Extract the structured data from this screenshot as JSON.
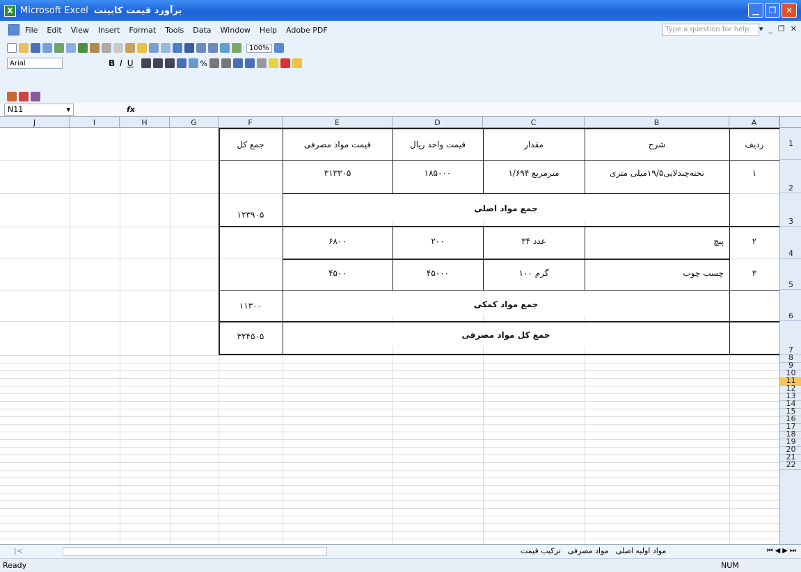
{
  "window": {
    "title": "برآورد قیمت کابینت",
    "app": "Microsoft Excel"
  },
  "menu": [
    "File",
    "Edit",
    "View",
    "Insert",
    "Format",
    "Tools",
    "Data",
    "Window",
    "Help",
    "Adobe PDF"
  ],
  "help_placeholder": "Type a question for help",
  "zoom": "100%",
  "font": "Arial",
  "name_box": "N11",
  "fx_label": "fx",
  "columns": [
    "J",
    "I",
    "H",
    "G",
    "F",
    "E",
    "D",
    "C",
    "B",
    "A"
  ],
  "rows": [
    "1",
    "2",
    "3",
    "4",
    "5",
    "6",
    "7",
    "8",
    "9",
    "10",
    "11",
    "12",
    "13",
    "14",
    "15",
    "16",
    "17",
    "18",
    "19",
    "20",
    "21",
    "22"
  ],
  "selected_row": "11",
  "sheet": {
    "headers": {
      "f": "جمع کل",
      "e": "قیمت مواد مصرفی",
      "d": "قیمت واحد ریال",
      "c": "مقدار",
      "b": "شرح",
      "a": "ردیف"
    },
    "rows": [
      {
        "a": "۱",
        "b": "تخته‌چندلایی۱۹/۵میلی متری",
        "c": "۱/۶۹۴ مترمربع",
        "d": "۱۸۵۰۰۰",
        "e": "۳۱۳۳۰۵"
      },
      {
        "a": "۲",
        "b": "پیچ",
        "c": "۳۴ عدد",
        "d": "۲۰۰",
        "e": "۶۸۰۰"
      },
      {
        "a": "۳",
        "b": "چسب چوب",
        "c": "۱۰۰ گرم",
        "d": "۴۵۰۰۰",
        "e": "۴۵۰۰"
      }
    ],
    "subtotal_main_label": "جمع مواد اصلی",
    "subtotal_main": "۱۲۳۹۰۵",
    "subtotal_aux_label": "جمع مواد کمکی",
    "subtotal_aux": "۱۱۳۰۰",
    "total_label": "جمع کل مواد مصرفی",
    "total": "۳۲۴۵۰۵"
  },
  "tabs": [
    "مواد اولیه اصلی",
    "مواد مصرفی",
    "ترکیب قیمت"
  ],
  "status": {
    "left": "Ready",
    "num": "NUM"
  }
}
